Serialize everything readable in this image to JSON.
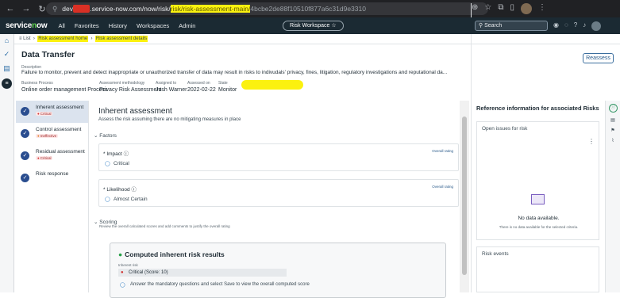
{
  "browser": {
    "url_host_prefix": "dev",
    "url_host_suffix": ".service-now.com/now/risk/",
    "url_path_hl": "risk/risk-assessment-main/",
    "url_path_rest": "4bcbe2de88f10510f877a6c31d9e3310"
  },
  "app": {
    "logo": "servicenow",
    "menu": [
      "All",
      "Favorites",
      "History",
      "Workspaces",
      "Admin"
    ],
    "workspace_pill": "Risk Workspace ☆",
    "search_placeholder": "Search"
  },
  "breadcrumbs": {
    "list": "List",
    "home": "Risk assessment home",
    "details": "Risk assessment details"
  },
  "record": {
    "title": "Data Transfer",
    "reassess_label": "Reassess",
    "description_label": "Description",
    "description": "Failure to monitor, prevent and detect inappropriate or unauthorized transfer of data may result in risks to indivudals' privacy, fines, litigation, regulatory investigations and reputational da...",
    "meta": [
      {
        "label": "Business Process",
        "value": "Online order management Process"
      },
      {
        "label": "Assessment methodology",
        "value": "Privacy Risk Assessment"
      },
      {
        "label": "Assigned to",
        "value": "Josh Warner"
      },
      {
        "label": "Assessed on",
        "value": "2022-02-22"
      },
      {
        "label": "State",
        "value": "Monitor"
      }
    ]
  },
  "steps": [
    {
      "name": "Inherent assessment",
      "badge": "Critical"
    },
    {
      "name": "Control assessment",
      "badge": "Ineffective"
    },
    {
      "name": "Residual assessment",
      "badge": "Critical"
    },
    {
      "name": "Risk response",
      "badge": ""
    }
  ],
  "assessment": {
    "title": "Inherent assessment",
    "subtitle": "Assess the risk assuming there are no mitigating measures in place",
    "factors_label": "Factors",
    "factors": [
      {
        "name": "* Impact ⓘ",
        "overall": "Overall rating",
        "value": "Critical"
      },
      {
        "name": "* Likelihood ⓘ",
        "overall": "Overall rating",
        "value": "Almost Certain"
      }
    ],
    "scoring_label": "Scoring",
    "scoring_sub": "Review the overall calculated scores and add comments to justify the overall rating",
    "result_title": "Computed inherent risk results",
    "result_label": "Inherent risk",
    "result_value": "Critical (Score: 10)",
    "result_note": "Answer the mandatory questions and select Save to view the overall computed score"
  },
  "reference": {
    "title": "Reference information for associated Risks",
    "open_issues": "Open issues for risk",
    "no_data": "No data available.",
    "no_data_sub": "There is no data available for the selected criteria.",
    "risk_events": "Risk events"
  }
}
